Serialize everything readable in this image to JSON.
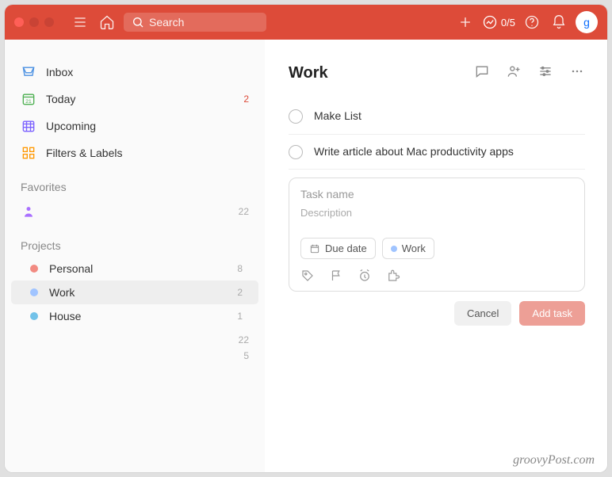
{
  "header": {
    "search_placeholder": "Search",
    "productivity": "0/5",
    "avatar": "g"
  },
  "sidebar": {
    "inbox_label": "Inbox",
    "today_label": "Today",
    "today_count": "2",
    "upcoming_label": "Upcoming",
    "filters_label": "Filters & Labels",
    "favorites_header": "Favorites",
    "favorites": [
      {
        "count": "22"
      }
    ],
    "projects_header": "Projects",
    "projects": [
      {
        "label": "Personal",
        "count": "8",
        "color": "#f28b82"
      },
      {
        "label": "Work",
        "count": "2",
        "color": "#a0c4ff"
      },
      {
        "label": "House",
        "count": "1",
        "color": "#72c2e9"
      }
    ],
    "summary_counts": [
      "22",
      "5"
    ]
  },
  "main": {
    "project_title": "Work",
    "tasks": [
      {
        "title": "Make List"
      },
      {
        "title": "Write article about Mac productivity apps"
      }
    ],
    "composer": {
      "name_placeholder": "Task name",
      "desc_placeholder": "Description",
      "due_label": "Due date",
      "project_chip": "Work",
      "project_chip_color": "#a0c4ff",
      "cancel_label": "Cancel",
      "add_label": "Add task"
    }
  },
  "watermark": "groovyPost.com"
}
